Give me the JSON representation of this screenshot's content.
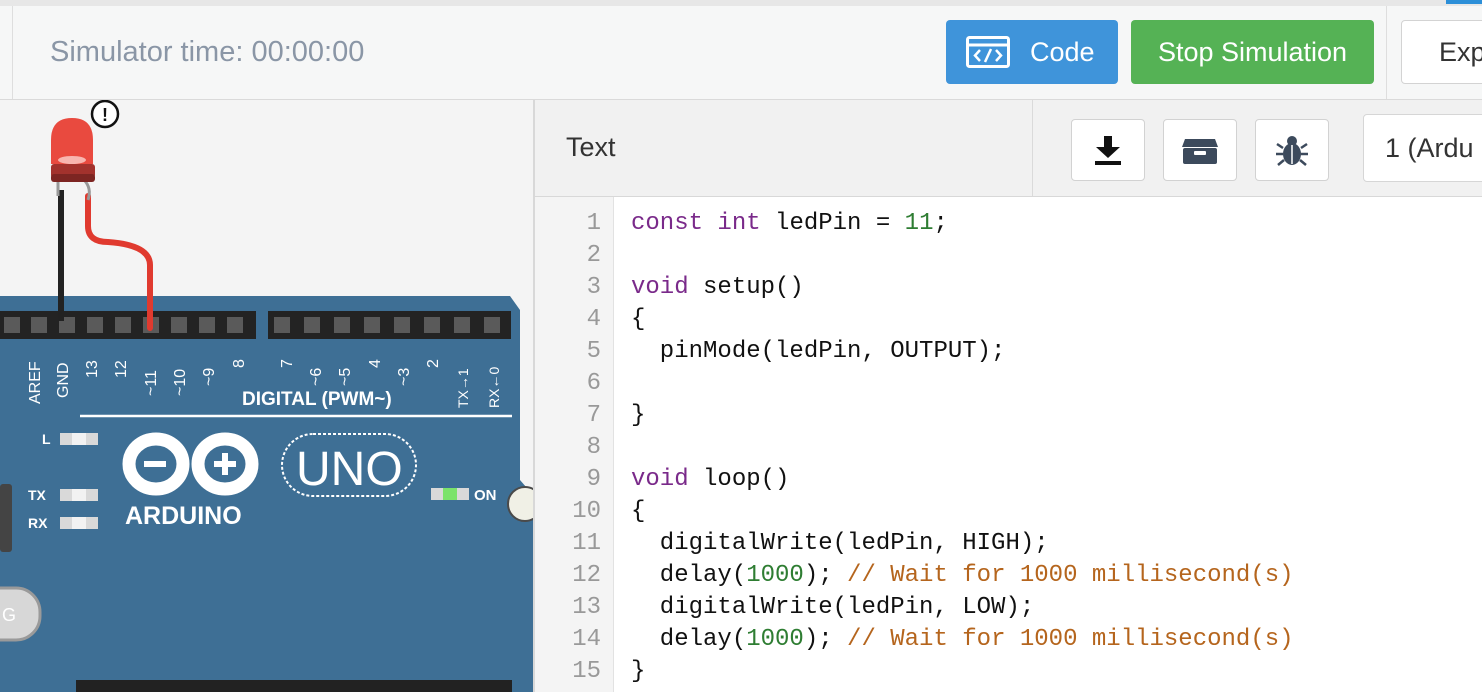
{
  "toolbar": {
    "simulator_time": "Simulator time: 00:00:00",
    "code_button": "Code",
    "stop_button": "Stop Simulation",
    "export_button": "Exp"
  },
  "editor": {
    "mode": "Text",
    "device": "1 (Ardu",
    "icons": [
      "download-icon",
      "library-icon",
      "debug-bug-icon"
    ],
    "lines": [
      [
        {
          "t": "const",
          "c": "kw"
        },
        {
          "t": " "
        },
        {
          "t": "int",
          "c": "kw"
        },
        {
          "t": " ledPin = "
        },
        {
          "t": "11",
          "c": "num"
        },
        {
          "t": ";"
        }
      ],
      [],
      [
        {
          "t": "void",
          "c": "kw"
        },
        {
          "t": " setup()"
        }
      ],
      [
        {
          "t": "{"
        }
      ],
      [
        {
          "t": "  pinMode(ledPin, OUTPUT);"
        }
      ],
      [],
      [
        {
          "t": "}"
        }
      ],
      [],
      [
        {
          "t": "void",
          "c": "kw"
        },
        {
          "t": " loop()"
        }
      ],
      [
        {
          "t": "{"
        }
      ],
      [
        {
          "t": "  digitalWrite(ledPin, HIGH);"
        }
      ],
      [
        {
          "t": "  delay("
        },
        {
          "t": "1000",
          "c": "num"
        },
        {
          "t": "); "
        },
        {
          "t": "// Wait for 1000 millisecond(s)",
          "c": "cm"
        }
      ],
      [
        {
          "t": "  digitalWrite(ledPin, LOW);"
        }
      ],
      [
        {
          "t": "  delay("
        },
        {
          "t": "1000",
          "c": "num"
        },
        {
          "t": "); "
        },
        {
          "t": "// Wait for 1000 millisecond(s)",
          "c": "cm"
        }
      ],
      [
        {
          "t": "}"
        }
      ]
    ]
  },
  "board": {
    "brand": "ARDUINO",
    "model": "UNO",
    "header_label": "DIGITAL (PWM~)",
    "on_label": "ON",
    "led_labels": [
      "L",
      "TX",
      "RX"
    ],
    "pin_labels_left": [
      "AREF",
      "GND",
      "13",
      "12",
      "~11",
      "~10",
      "~9",
      "8"
    ],
    "pin_labels_right": [
      "7",
      "~6",
      "~5",
      "4",
      "~3",
      "2",
      "TX→1",
      "RX←0"
    ],
    "warning_mark": "!",
    "partial_g": "G"
  },
  "colors": {
    "board": "#3e6f95",
    "code_button": "#3f94da",
    "stop_button": "#55b255",
    "led_red": "#e94a3f",
    "wire_red": "#e03a2f",
    "wire_black": "#222222",
    "power_led": "#7be36b"
  }
}
